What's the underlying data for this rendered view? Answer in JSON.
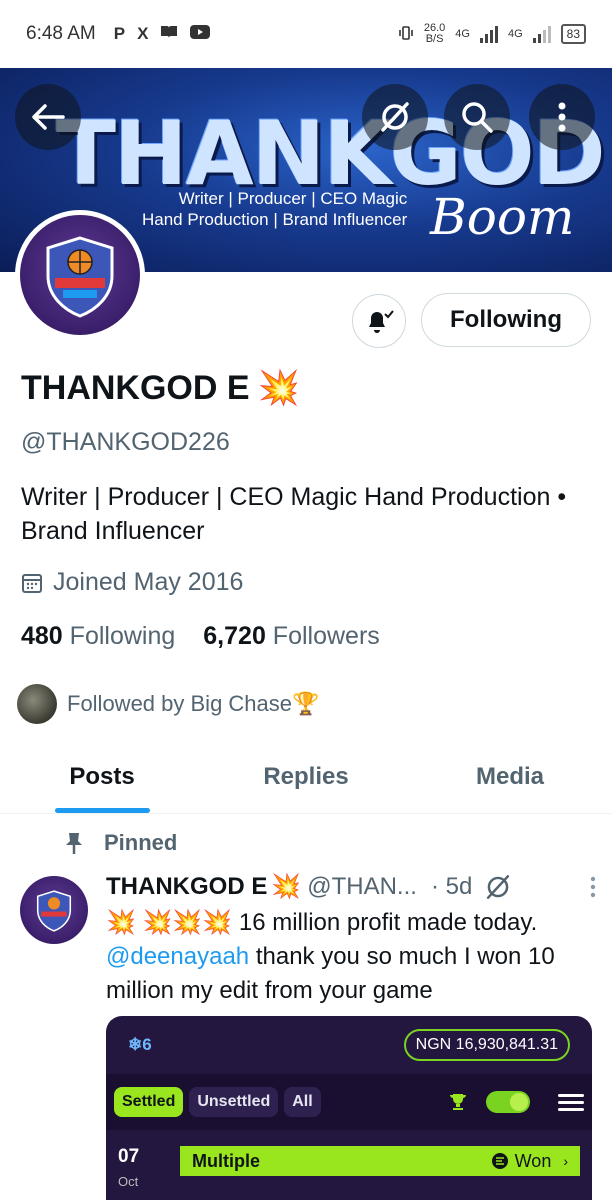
{
  "status_bar": {
    "time": "6:48 AM",
    "app_icons": [
      "P",
      "X"
    ],
    "net_speed_value": "26.0",
    "net_speed_unit": "B/S",
    "net_type_1": "4G",
    "net_type_2": "4G",
    "battery": "83"
  },
  "banner": {
    "title": "THANKGOD E",
    "subtitle_line1": "Writer | Producer | CEO Magic",
    "subtitle_line2": "Hand Production | Brand Influencer",
    "script_text": "Boom"
  },
  "profile": {
    "display_name": "THANKGOD E",
    "name_emoji": "💥",
    "handle": "@THANKGOD226",
    "bio_line1": "Writer | Producer | CEO Magic Hand Production  •",
    "bio_line2": "Brand Influencer",
    "joined": "Joined May 2016",
    "following_count": "480",
    "following_label": "Following",
    "followers_count": "6,720",
    "followers_label": "Followers",
    "followed_by": "Followed by Big Chase🏆",
    "following_button": "Following",
    "avatar_text": "BASKETBALL"
  },
  "tabs": [
    "Posts",
    "Replies",
    "Media"
  ],
  "post": {
    "pinned_label": "Pinned",
    "author_name": "THANKGOD E",
    "author_emoji": "💥",
    "author_handle": "@THAN...",
    "time": "· 5d",
    "text_emojis": "💥 💥💥💥",
    "text_part1": " 16 million profit made today.",
    "mention": "@deenayaah",
    "text_part2": "  thank you so much I won 10 million my edit from your game"
  },
  "embed": {
    "snow_count": "❄6",
    "balance": "NGN 16,930,841.31",
    "tabs": [
      "Settled",
      "Unsettled",
      "All"
    ],
    "row_day": "07",
    "row_month": "Oct",
    "row_title": "Multiple",
    "row_status": "Won"
  },
  "colors": {
    "accent": "#1d9bf0",
    "text_primary": "#0f1419",
    "text_secondary": "#536471",
    "embed_green": "#9ae61e"
  }
}
